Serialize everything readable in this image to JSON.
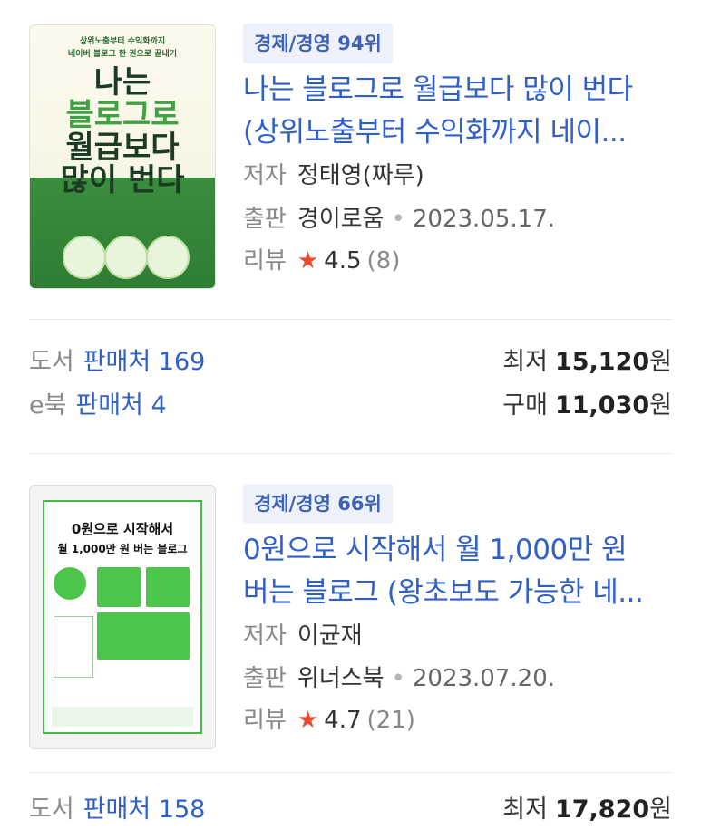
{
  "items": [
    {
      "badge": "경제/경영 94위",
      "title_line1": "나는 블로그로 월급보다 많이 번다",
      "title_line2": "(상위노출부터 수익화까지 네이...",
      "author_label": "저자",
      "author": "정태영(짜루)",
      "publisher_label": "출판",
      "publisher": "경이로움",
      "date": "2023.05.17.",
      "review_label": "리뷰",
      "rating": "4.5",
      "review_count": "(8)",
      "cover": {
        "top_small": "상위노출부터 수익화까지",
        "top_small2": "네이버 블로그 한 권으로 끝내기",
        "big1": "나는",
        "big2": "블로그로",
        "big3": "월급보다",
        "big4": "많이 번다"
      },
      "book_row": {
        "kind": "도서",
        "seller": "판매처 169",
        "price_label": "최저",
        "price": "15,120",
        "won": "원"
      },
      "ebook_row": {
        "kind": "e북",
        "seller": "판매처 4",
        "price_label": "구매",
        "price": "11,030",
        "won": "원"
      }
    },
    {
      "badge": "경제/경영 66위",
      "title_line1": "0원으로 시작해서 월 1,000만 원",
      "title_line2": "버는 블로그 (왕초보도 가능한 네...",
      "author_label": "저자",
      "author": "이균재",
      "publisher_label": "출판",
      "publisher": "위너스북",
      "date": "2023.07.20.",
      "review_label": "리뷰",
      "rating": "4.7",
      "review_count": "(21)",
      "cover": {
        "big1": "0원으로 시작해서",
        "big2": "월 1,000만 원 버는 블로그"
      },
      "book_row": {
        "kind": "도서",
        "seller": "판매처 158",
        "price_label": "최저",
        "price": "17,820",
        "won": "원"
      }
    }
  ],
  "colors": {
    "accent": "#2f5fc8",
    "star": "#e64a33",
    "badge_bg": "#eef1f9"
  }
}
